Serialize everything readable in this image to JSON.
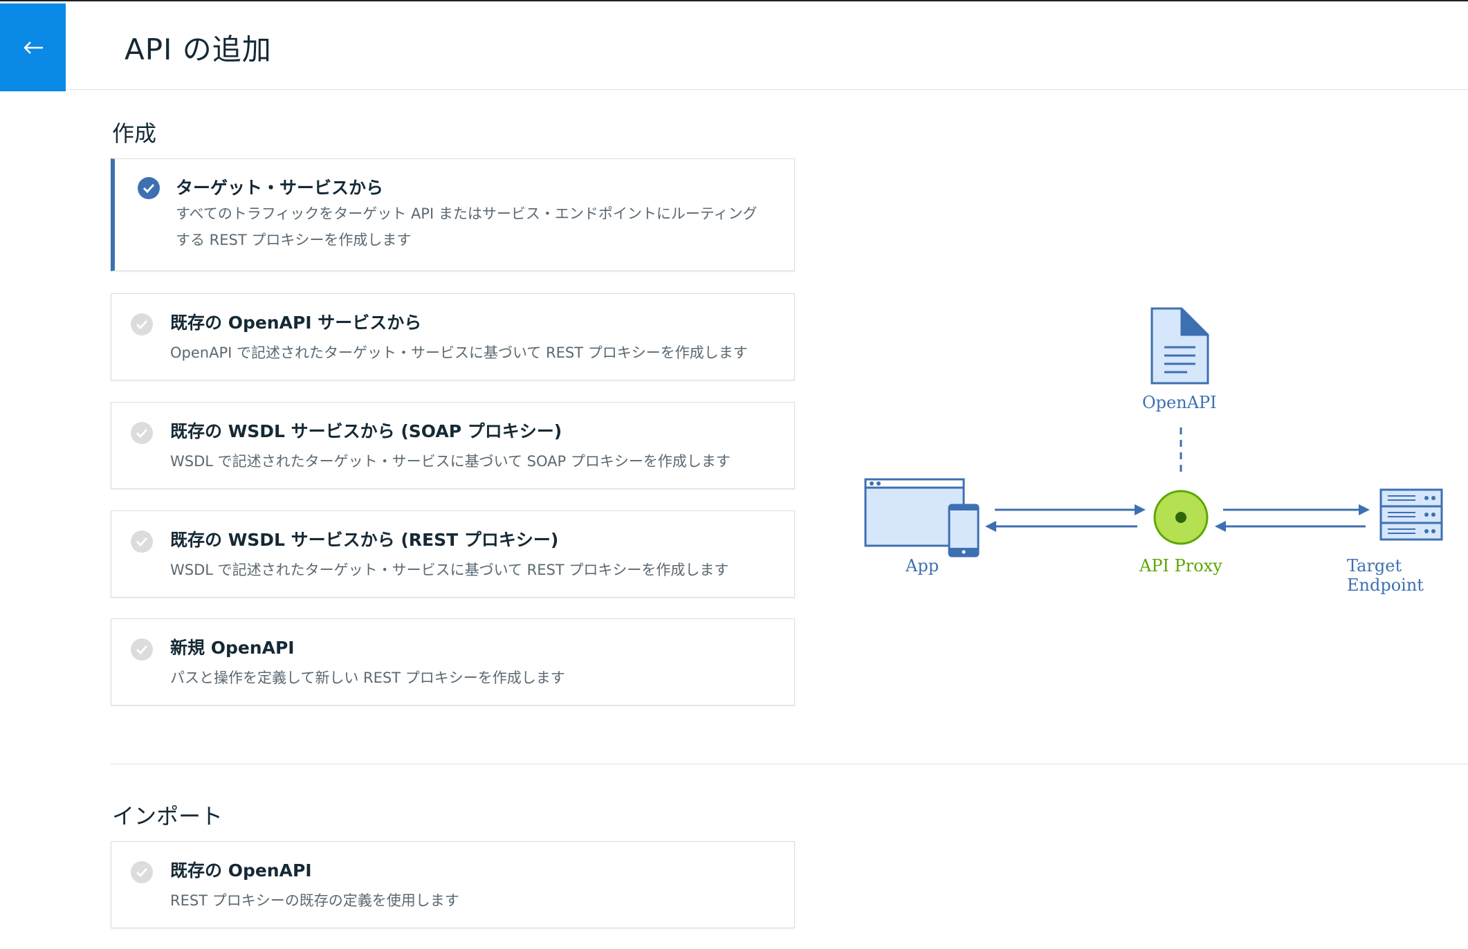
{
  "header": {
    "back_label": "←",
    "title": "API の追加"
  },
  "create_section": {
    "title": "作成",
    "cards": [
      {
        "title": "ターゲット・サービスから",
        "description": "すべてのトラフィックをターゲット API またはサービス・エンドポイントにルーティングする REST プロキシーを作成します",
        "selected": true
      },
      {
        "title": "既存の OpenAPI サービスから",
        "description": "OpenAPI で記述されたターゲット・サービスに基づいて REST プロキシーを作成します",
        "selected": false
      },
      {
        "title": "既存の WSDL サービスから (SOAP プロキシー)",
        "description": "WSDL で記述されたターゲット・サービスに基づいて SOAP プロキシーを作成します",
        "selected": false
      },
      {
        "title": "既存の WSDL サービスから (REST プロキシー)",
        "description": "WSDL で記述されたターゲット・サービスに基づいて REST プロキシーを作成します",
        "selected": false
      },
      {
        "title": "新規 OpenAPI",
        "description": "パスと操作を定義して新しい REST プロキシーを作成します",
        "selected": false
      }
    ]
  },
  "import_section": {
    "title": "インポート",
    "cards": [
      {
        "title": "既存の OpenAPI",
        "description": "REST プロキシーの既存の定義を使用します",
        "selected": false
      }
    ]
  },
  "diagram": {
    "openapi_label": "OpenAPI",
    "app_label": "App",
    "proxy_label": "API Proxy",
    "target_label": "Target Endpoint",
    "colors": {
      "blue": "#3d70b2",
      "green": "#5aa700",
      "green_fill": "#b4e051"
    }
  }
}
